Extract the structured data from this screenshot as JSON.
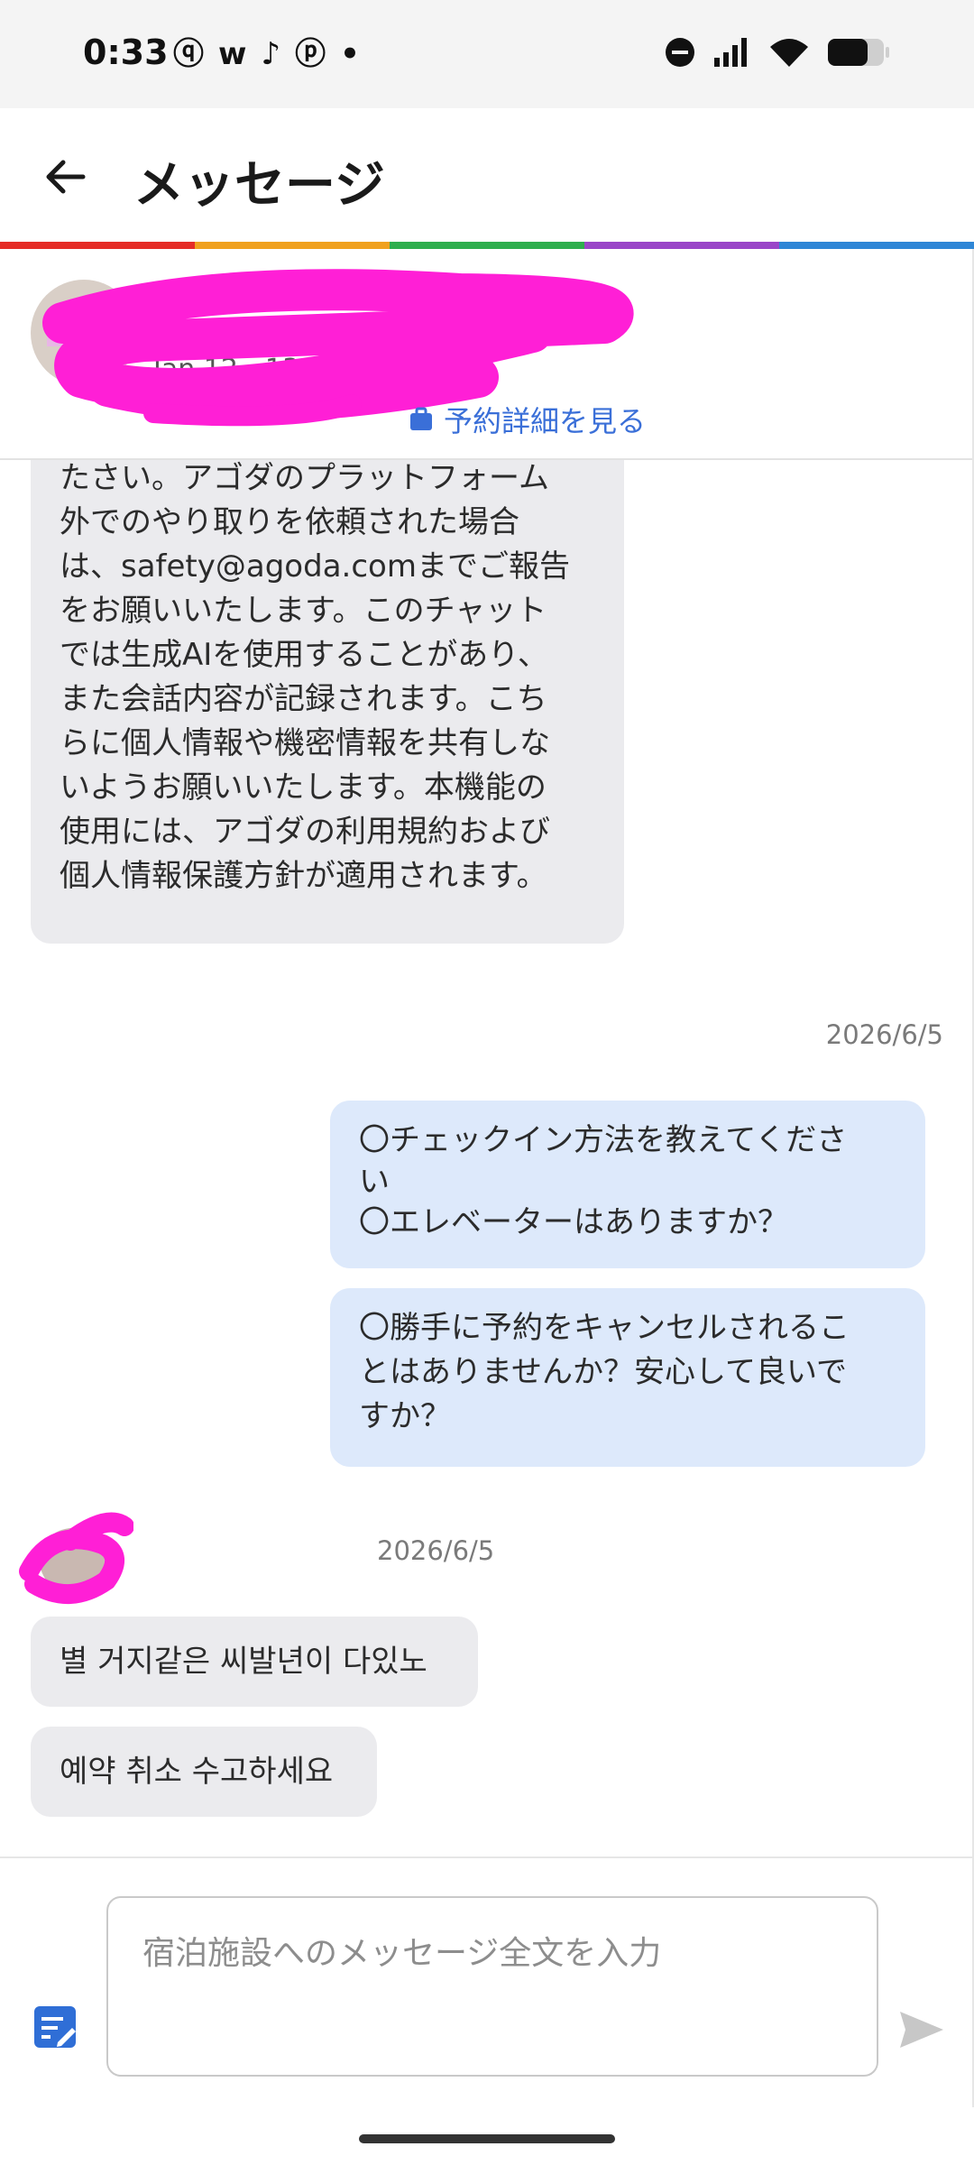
{
  "status_bar": {
    "time": "0:33",
    "left_icons": [
      "threads-icon",
      "wattpad-icon",
      "tiktok-icon",
      "pinterest-icon",
      "dot-icon"
    ],
    "left_glyphs": [
      "ⓠ",
      "w",
      "♪",
      "ⓟ",
      "•"
    ],
    "right_icons": [
      "dnd-icon",
      "signal-icon",
      "wifi-icon",
      "battery-icon"
    ]
  },
  "app_bar": {
    "title": "メッセージ"
  },
  "rainbow_colors": [
    "#e52d27",
    "#f0a11f",
    "#2fae4e",
    "#9a46c8",
    "#2f86d6"
  ],
  "booking": {
    "dates": "Jan 12 - 13",
    "details_link": "予約詳細を見る",
    "link_color": "#3a6fd8"
  },
  "messages": {
    "system_text_lines": [
      "たさい。アゴダのプラットフォーム",
      "外でのやり取りを依頼された場合",
      "は、safety@agoda.comまでご報告",
      "をお願いいたします。このチャット",
      "では生成AIを使用することがあり、",
      "また会話内容が記録されます。こち",
      "らに個人情報や機密情報を共有しな",
      "いようお願いいたします。本機能の",
      "使用には、アゴダの利用規約および",
      "個人情報保護方針が適用されます。"
    ],
    "date_1": "2026/6/5",
    "out_1_lines": [
      "〇チェックイン方法を教えてくださ",
      "い",
      "〇エレベーターはありますか？"
    ],
    "out_2_lines": [
      "〇勝手に予約をキャンセルされるこ",
      "とはありませんか？安心して良いで",
      "すか？"
    ],
    "date_2": "2026/6/5",
    "in_1": "별 거지같은 씨발년이 다있노",
    "in_2": "예약 취소 수고하세요"
  },
  "composer": {
    "placeholder": "宿泊施設へのメッセージ全文を入力"
  },
  "colors": {
    "incoming_bubble": "#ebebee",
    "outgoing_bubble": "#dde9fb",
    "redaction": "#ff1fd6",
    "accent": "#3a6fd8"
  }
}
